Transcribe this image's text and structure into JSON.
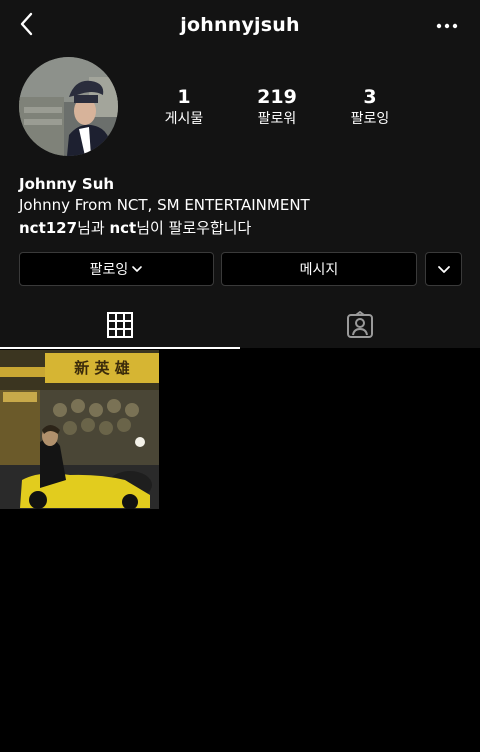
{
  "header": {
    "username": "johnnyjsuh"
  },
  "profile": {
    "avatar_icon": "profile-photo",
    "stats": [
      {
        "value": "1",
        "label": "게시물"
      },
      {
        "value": "219",
        "label": "팔로워"
      },
      {
        "value": "3",
        "label": "팔로잉"
      }
    ],
    "name": "Johnny Suh",
    "bio": "Johnny From NCT, SM ENTERTAINMENT",
    "followed_by": {
      "user1": "nct127",
      "connector": "님과 ",
      "user2": "nct",
      "suffix": "님이 팔로우합니다"
    }
  },
  "actions": {
    "following_label": "팔로잉",
    "message_label": "메시지"
  },
  "tabs": [
    {
      "name": "grid",
      "icon": "grid-icon",
      "active": true
    },
    {
      "name": "tagged",
      "icon": "tagged-person-icon",
      "active": false
    }
  ],
  "post_sign": "新 英 雄",
  "colors": {
    "background": "#000000",
    "panel": "#131313",
    "border": "#3a3a3a",
    "text": "#ffffff"
  }
}
